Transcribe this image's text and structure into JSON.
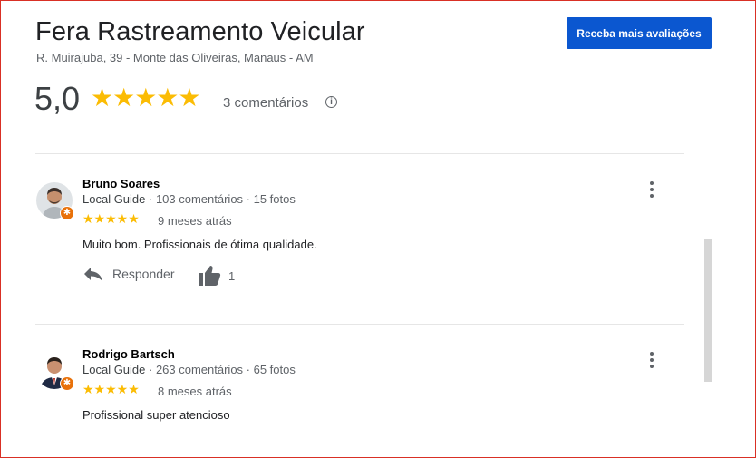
{
  "header": {
    "title": "Fera Rastreamento Veicular",
    "address": "R. Muirajuba, 39 - Monte das Oliveiras, Manaus - AM",
    "cta_label": "Receba mais avaliações"
  },
  "summary": {
    "rating": "5,0",
    "stars": "★★★★★",
    "star_count": 5,
    "reviews_count": "3 comentários",
    "info_icon": "info-icon"
  },
  "reviews": [
    {
      "name": "Bruno Soares",
      "guide": "Local Guide",
      "stats": " · 103 comentários · 15 fotos",
      "stars": "★★★★★",
      "rating": 5,
      "when": "9 meses atrás",
      "text": "Muito bom. Profissionais de ótima qualidade.",
      "reply_label": "Responder",
      "likes": "1"
    },
    {
      "name": "Rodrigo Bartsch",
      "guide": "Local Guide",
      "stats": " · 263 comentários · 65 fotos",
      "stars": "★★★★★",
      "rating": 5,
      "when": "8 meses atrás",
      "text": "Profissional super atencioso"
    }
  ],
  "colors": {
    "star": "#fbbc04",
    "cta_bg": "#0b57d0",
    "badge": "#e8710a",
    "frame": "#d93025"
  }
}
